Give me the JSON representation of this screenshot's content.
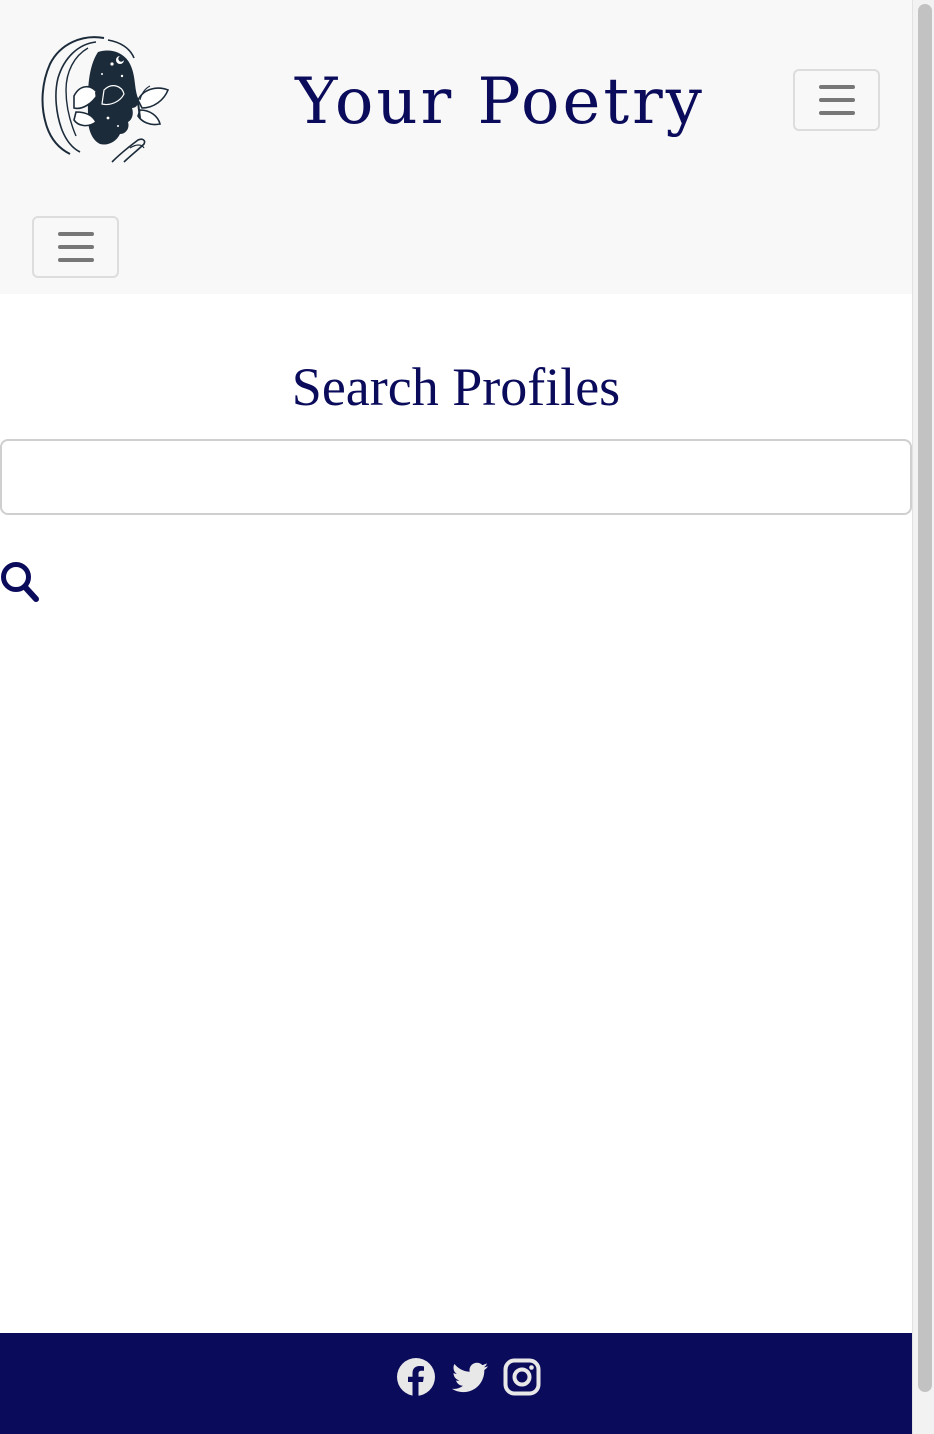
{
  "header": {
    "brand_title": "Your Poetry",
    "logo_icon": "woman-butterfly-logo",
    "menu_toggle_icon": "hamburger-icon"
  },
  "main": {
    "title": "Search Profiles",
    "search": {
      "value": "",
      "placeholder": "",
      "button_icon": "search-icon"
    }
  },
  "footer": {
    "social_icons": [
      "facebook-icon",
      "twitter-icon",
      "instagram-icon"
    ]
  },
  "colors": {
    "brand_navy": "#0b0b5c",
    "navbar_bg": "#f8f8f8",
    "toggler_bars": "#777777",
    "footer_icons": "#e8e8e8"
  }
}
